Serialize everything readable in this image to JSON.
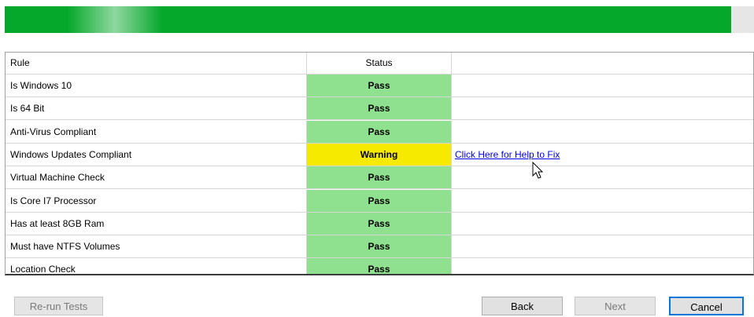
{
  "progress": {
    "value": 0.97,
    "color": "#06a82b"
  },
  "table": {
    "headers": [
      "Rule",
      "Status",
      ""
    ],
    "rows": [
      {
        "rule": "Is Windows 10",
        "status": "Pass",
        "action": ""
      },
      {
        "rule": "Is 64 Bit",
        "status": "Pass",
        "action": ""
      },
      {
        "rule": "Anti-Virus Compliant",
        "status": "Pass",
        "action": ""
      },
      {
        "rule": "Windows Updates Compliant",
        "status": "Warning",
        "action": "Click Here for Help to Fix"
      },
      {
        "rule": "Virtual Machine Check",
        "status": "Pass",
        "action": ""
      },
      {
        "rule": "Is Core I7 Processor",
        "status": "Pass",
        "action": ""
      },
      {
        "rule": "Has at least 8GB Ram",
        "status": "Pass",
        "action": ""
      },
      {
        "rule": "Must have NTFS Volumes",
        "status": "Pass",
        "action": ""
      },
      {
        "rule": "Location Check",
        "status": "Pass",
        "action": ""
      }
    ]
  },
  "status_colors": {
    "Pass": "#8fe08f",
    "Warning": "#f6ea00"
  },
  "buttons": {
    "rerun": "Re-run Tests",
    "back": "Back",
    "next": "Next",
    "cancel": "Cancel"
  }
}
